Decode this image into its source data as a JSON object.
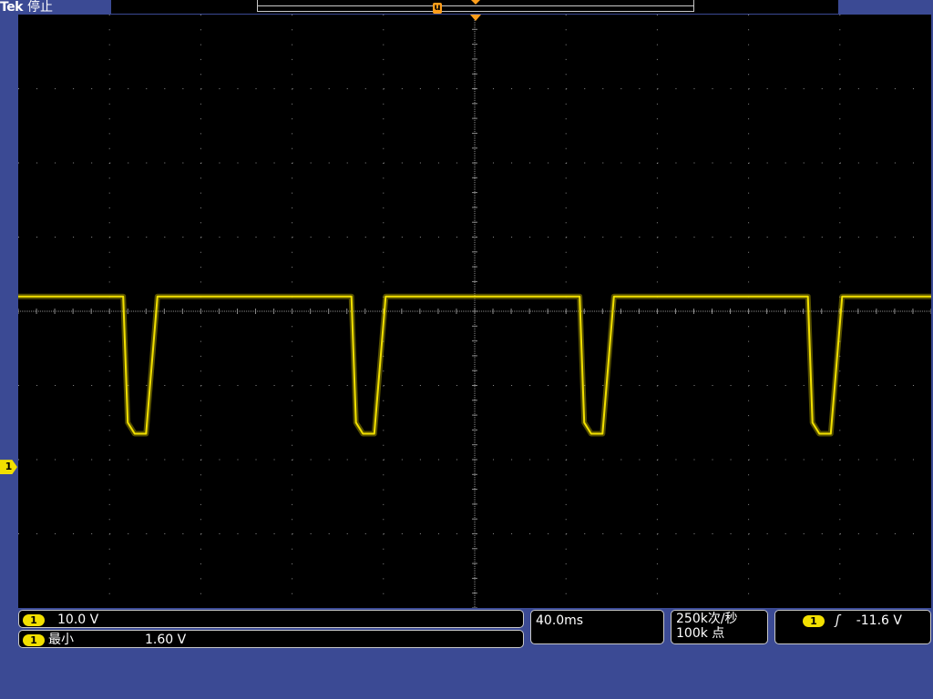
{
  "header": {
    "brand": "Tek",
    "acq_state": "停止"
  },
  "record_bar": {
    "trigger_label": "u"
  },
  "colors": {
    "background": "#3b4a94",
    "screen": "#000000",
    "ch1_trace": "#f2e000",
    "trigger_marker": "#ff9e1a",
    "grid": "#8c8c8c"
  },
  "ch1": {
    "marker": "1",
    "scale": "10.0 V",
    "offset_divisions": -2.1
  },
  "measurement": {
    "channel": "1",
    "label": "最小",
    "value": "1.60 V"
  },
  "horizontal": {
    "timebase": "40.0ms"
  },
  "acquisition": {
    "sample_rate": "250k次/秒",
    "record_length": "100k 点"
  },
  "trigger": {
    "channel": "1",
    "slope_icon": "rising-edge-icon",
    "slope_glyph": "ʃ",
    "level": "-11.6 V"
  },
  "chart_data": {
    "type": "line",
    "x_divisions": 10,
    "y_divisions": 8,
    "time_per_div_ms": 40.0,
    "volts_per_div": 10.0,
    "series": [
      {
        "points_div": [
          [
            0.0,
            2.3
          ],
          [
            2.3,
            2.3
          ],
          [
            2.4,
            0.6
          ],
          [
            2.55,
            0.45
          ],
          [
            2.8,
            0.45
          ],
          [
            3.05,
            2.3
          ],
          [
            7.3,
            2.3
          ],
          [
            7.4,
            0.6
          ],
          [
            7.55,
            0.45
          ],
          [
            7.8,
            0.45
          ],
          [
            8.05,
            2.3
          ],
          [
            12.3,
            2.3
          ],
          [
            12.4,
            0.6
          ],
          [
            12.55,
            0.45
          ],
          [
            12.8,
            0.45
          ],
          [
            13.05,
            2.3
          ],
          [
            17.3,
            2.3
          ],
          [
            17.4,
            0.6
          ],
          [
            17.55,
            0.45
          ],
          [
            17.8,
            0.45
          ],
          [
            18.05,
            2.3
          ],
          [
            20.0,
            2.3
          ]
        ]
      }
    ]
  }
}
